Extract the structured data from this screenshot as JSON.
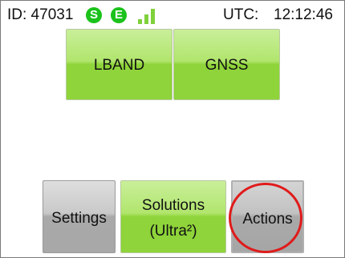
{
  "status_bar": {
    "device_id": "ID: 47031",
    "badge_s": "S",
    "badge_e": "E",
    "signal_icon": "signal-strength-icon",
    "utc_label": "UTC:",
    "utc_time": "12:12:46",
    "badge_color": "#1bc21b",
    "signal_color": "#7fd13b"
  },
  "top_buttons": {
    "lband_label": "LBAND",
    "gnss_label": "GNSS"
  },
  "bottom_buttons": {
    "settings_label": "Settings",
    "solutions_line1": "Solutions",
    "solutions_line2": "(Ultra²)",
    "actions_label": "Actions"
  },
  "colors": {
    "active_green": "#8ed43a",
    "inactive_gray": "#a8a8a8",
    "highlight_red": "#e01b1b"
  }
}
